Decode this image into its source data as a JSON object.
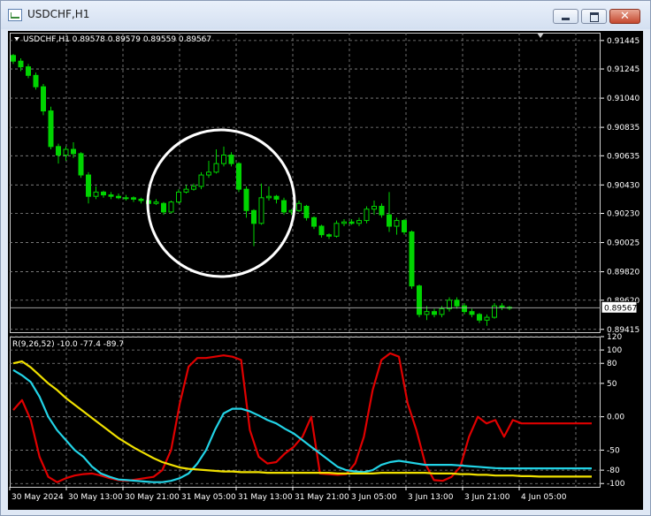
{
  "window": {
    "title": "USDCHF,H1",
    "close_glyph": "✕"
  },
  "colors": {
    "background": "#000000",
    "grid": "#8a8a8a",
    "bull": "#00d400",
    "bear": "#00d400",
    "text": "#ffffff",
    "red": "#e00000",
    "cyan": "#22d3e6",
    "yellow": "#f0e000",
    "circle": "#ffffff"
  },
  "chart_data": [
    {
      "type": "candlestick",
      "title": "USDCHF,H1  0.89578 0.89579 0.89559 0.89567",
      "price_ticks": [
        "0.91445",
        "0.91245",
        "0.91040",
        "0.90835",
        "0.90635",
        "0.90430",
        "0.90230",
        "0.90025",
        "0.89820",
        "0.89620",
        "0.89415"
      ],
      "current_price": "0.89567",
      "current_price_value": 0.89567,
      "ylim": [
        0.89395,
        0.915
      ],
      "x_labels": [
        "30 May 2024",
        "30 May 13:00",
        "30 May 21:00",
        "31 May 05:00",
        "31 May 13:00",
        "31 May 21:00",
        "3 Jun 05:00",
        "3 Jun 13:00",
        "3 Jun 21:00",
        "4 Jun 05:00"
      ],
      "candles": [
        [
          0.9134,
          0.9135,
          0.9128,
          0.913
        ],
        [
          0.913,
          0.9132,
          0.9123,
          0.9126
        ],
        [
          0.9126,
          0.9128,
          0.9118,
          0.912
        ],
        [
          0.912,
          0.9122,
          0.911,
          0.9112
        ],
        [
          0.9112,
          0.9114,
          0.9092,
          0.9095
        ],
        [
          0.9095,
          0.9098,
          0.9068,
          0.907
        ],
        [
          0.907,
          0.9072,
          0.9058,
          0.9064
        ],
        [
          0.9064,
          0.907,
          0.906,
          0.9068
        ],
        [
          0.9068,
          0.9073,
          0.9062,
          0.9065
        ],
        [
          0.9065,
          0.9066,
          0.9048,
          0.905
        ],
        [
          0.905,
          0.9052,
          0.903,
          0.9035
        ],
        [
          0.9035,
          0.9042,
          0.9033,
          0.9038
        ],
        [
          0.9038,
          0.9039,
          0.9034,
          0.9036
        ],
        [
          0.9036,
          0.9038,
          0.9033,
          0.9035
        ],
        [
          0.9035,
          0.9037,
          0.9033,
          0.9034
        ],
        [
          0.9034,
          0.9036,
          0.9032,
          0.9034
        ],
        [
          0.9034,
          0.9035,
          0.9031,
          0.9033
        ],
        [
          0.9033,
          0.9034,
          0.903,
          0.9032
        ],
        [
          0.9032,
          0.9033,
          0.9029,
          0.903
        ],
        [
          0.903,
          0.9033,
          0.9029,
          0.9031
        ],
        [
          0.903,
          0.9031,
          0.9022,
          0.9024
        ],
        [
          0.9024,
          0.9032,
          0.9023,
          0.9031
        ],
        [
          0.9031,
          0.904,
          0.903,
          0.9038
        ],
        [
          0.9038,
          0.9043,
          0.9037,
          0.904
        ],
        [
          0.904,
          0.9044,
          0.9039,
          0.9042
        ],
        [
          0.9042,
          0.9052,
          0.904,
          0.905
        ],
        [
          0.905,
          0.906,
          0.9048,
          0.9052
        ],
        [
          0.9052,
          0.9068,
          0.9051,
          0.9058
        ],
        [
          0.9058,
          0.907,
          0.9056,
          0.9064
        ],
        [
          0.9064,
          0.9066,
          0.9056,
          0.9058
        ],
        [
          0.9058,
          0.9059,
          0.9038,
          0.904
        ],
        [
          0.904,
          0.9042,
          0.902,
          0.9025
        ],
        [
          0.9025,
          0.9026,
          0.9,
          0.9016
        ],
        [
          0.9016,
          0.9044,
          0.9015,
          0.9034
        ],
        [
          0.9034,
          0.9042,
          0.9032,
          0.9035
        ],
        [
          0.9035,
          0.9036,
          0.903,
          0.9033
        ],
        [
          0.9032,
          0.9034,
          0.9022,
          0.9024
        ],
        [
          0.9024,
          0.9026,
          0.9022,
          0.9025
        ],
        [
          0.9025,
          0.9032,
          0.9024,
          0.903
        ],
        [
          0.9028,
          0.9029,
          0.9018,
          0.902
        ],
        [
          0.902,
          0.9021,
          0.9012,
          0.9014
        ],
        [
          0.9014,
          0.9015,
          0.9006,
          0.9008
        ],
        [
          0.9008,
          0.9009,
          0.9005,
          0.9007
        ],
        [
          0.9007,
          0.9018,
          0.9006,
          0.9016
        ],
        [
          0.9016,
          0.9019,
          0.9014,
          0.9017
        ],
        [
          0.9017,
          0.9019,
          0.9015,
          0.9016
        ],
        [
          0.9016,
          0.902,
          0.9014,
          0.9018
        ],
        [
          0.9018,
          0.9028,
          0.9016,
          0.9026
        ],
        [
          0.9026,
          0.9032,
          0.9022,
          0.9028
        ],
        [
          0.9028,
          0.903,
          0.902,
          0.9022
        ],
        [
          0.9022,
          0.9038,
          0.901,
          0.9014
        ],
        [
          0.9014,
          0.902,
          0.9008,
          0.9018
        ],
        [
          0.9018,
          0.9019,
          0.9008,
          0.901
        ],
        [
          0.901,
          0.9011,
          0.897,
          0.8972
        ],
        [
          0.8972,
          0.8973,
          0.895,
          0.8952
        ],
        [
          0.8952,
          0.8958,
          0.8948,
          0.8954
        ],
        [
          0.8954,
          0.8956,
          0.895,
          0.8952
        ],
        [
          0.8952,
          0.8958,
          0.895,
          0.8956
        ],
        [
          0.8956,
          0.8964,
          0.8954,
          0.8962
        ],
        [
          0.8962,
          0.8964,
          0.8956,
          0.8958
        ],
        [
          0.8958,
          0.896,
          0.8952,
          0.8954
        ],
        [
          0.8954,
          0.8956,
          0.895,
          0.8952
        ],
        [
          0.8952,
          0.8953,
          0.8946,
          0.8948
        ],
        [
          0.8948,
          0.8952,
          0.8944,
          0.895
        ],
        [
          0.895,
          0.896,
          0.8949,
          0.8958
        ],
        [
          0.8958,
          0.896,
          0.8955,
          0.8957
        ],
        [
          0.8957,
          0.8958,
          0.8955,
          0.89567
        ]
      ],
      "annotation": "circle"
    },
    {
      "type": "line",
      "title": "R(9,26,52) -10.0 -77.4 -89.7",
      "ylim": [
        -105,
        120
      ],
      "y_ticks": [
        "120",
        "100",
        "80",
        "50",
        "0.00",
        "-50",
        "-80",
        "-100"
      ],
      "y_tick_values": [
        120,
        100,
        80,
        50,
        0,
        -50,
        -80,
        -100
      ],
      "series": [
        {
          "color": "#e00000",
          "x": [
            0,
            1,
            2,
            3,
            4,
            5,
            6,
            7,
            8,
            9,
            10,
            11,
            12,
            13,
            14,
            15,
            16,
            17,
            18,
            19,
            20,
            21,
            22,
            23,
            24,
            25,
            26,
            27,
            28,
            29,
            30,
            31,
            32,
            33,
            34,
            35,
            36,
            37,
            38,
            39,
            40,
            41,
            42,
            43,
            44,
            45,
            46,
            47,
            48,
            49,
            50,
            51,
            52,
            53,
            54,
            55,
            56,
            57,
            58,
            59,
            60,
            61,
            62,
            63,
            64,
            65,
            66
          ],
          "values": [
            10,
            25,
            -5,
            -60,
            -90,
            -98,
            -92,
            -88,
            -86,
            -85,
            -88,
            -92,
            -95,
            -96,
            -94,
            -92,
            -90,
            -80,
            -50,
            20,
            75,
            88,
            88,
            90,
            92,
            90,
            85,
            -20,
            -60,
            -70,
            -68,
            -55,
            -45,
            -30,
            0,
            -85,
            -86,
            -87,
            -86,
            -70,
            -30,
            40,
            85,
            95,
            90,
            20,
            -20,
            -70,
            -95,
            -96,
            -90,
            -75,
            -30,
            0,
            -10,
            -5,
            -30,
            -5,
            -10,
            -10,
            -10,
            -10,
            -10,
            -10,
            -10,
            -10,
            -10
          ]
        },
        {
          "color": "#22d3e6",
          "x": [
            0,
            1,
            2,
            3,
            4,
            5,
            6,
            7,
            8,
            9,
            10,
            11,
            12,
            13,
            14,
            15,
            16,
            17,
            18,
            19,
            20,
            21,
            22,
            23,
            24,
            25,
            26,
            27,
            28,
            29,
            30,
            31,
            32,
            33,
            34,
            35,
            36,
            37,
            38,
            39,
            40,
            41,
            42,
            43,
            44,
            45,
            46,
            47,
            48,
            49,
            50,
            51,
            52,
            53,
            54,
            55,
            56,
            57,
            58,
            59,
            60,
            61,
            62,
            63,
            64,
            65,
            66
          ],
          "values": [
            70,
            62,
            52,
            30,
            0,
            -20,
            -35,
            -50,
            -60,
            -75,
            -85,
            -90,
            -94,
            -95,
            -96,
            -97,
            -98,
            -98,
            -96,
            -92,
            -85,
            -70,
            -50,
            -20,
            5,
            12,
            12,
            8,
            2,
            -5,
            -10,
            -18,
            -25,
            -35,
            -45,
            -55,
            -65,
            -75,
            -80,
            -82,
            -83,
            -80,
            -72,
            -68,
            -66,
            -68,
            -70,
            -72,
            -72,
            -72,
            -72,
            -73,
            -74,
            -75,
            -76,
            -77,
            -77.4,
            -77.4,
            -77.4,
            -77.4,
            -77.4,
            -77.4,
            -77.4,
            -77.4,
            -77.4,
            -77.4,
            -77.4
          ]
        },
        {
          "color": "#f0e000",
          "x": [
            0,
            1,
            2,
            3,
            4,
            5,
            6,
            7,
            8,
            9,
            10,
            11,
            12,
            13,
            14,
            15,
            16,
            17,
            18,
            19,
            20,
            21,
            22,
            23,
            24,
            25,
            26,
            27,
            28,
            29,
            30,
            31,
            32,
            33,
            34,
            35,
            36,
            37,
            38,
            39,
            40,
            41,
            42,
            43,
            44,
            45,
            46,
            47,
            48,
            49,
            50,
            51,
            52,
            53,
            54,
            55,
            56,
            57,
            58,
            59,
            60,
            61,
            62,
            63,
            64,
            65,
            66
          ],
          "values": [
            80,
            83,
            74,
            62,
            50,
            40,
            28,
            18,
            8,
            -2,
            -12,
            -22,
            -32,
            -40,
            -48,
            -55,
            -62,
            -68,
            -72,
            -76,
            -78,
            -79,
            -80,
            -81,
            -82,
            -82,
            -83,
            -83,
            -83,
            -84,
            -84,
            -84,
            -84,
            -84,
            -84,
            -84,
            -84,
            -85,
            -85,
            -85,
            -85,
            -85,
            -84,
            -84,
            -84,
            -84,
            -84,
            -84,
            -85,
            -85,
            -85,
            -86,
            -86,
            -87,
            -87,
            -88,
            -88,
            -88,
            -89,
            -89,
            -89.7,
            -89.7,
            -89.7,
            -89.7,
            -89.7,
            -89.7,
            -89.7
          ]
        }
      ]
    }
  ]
}
